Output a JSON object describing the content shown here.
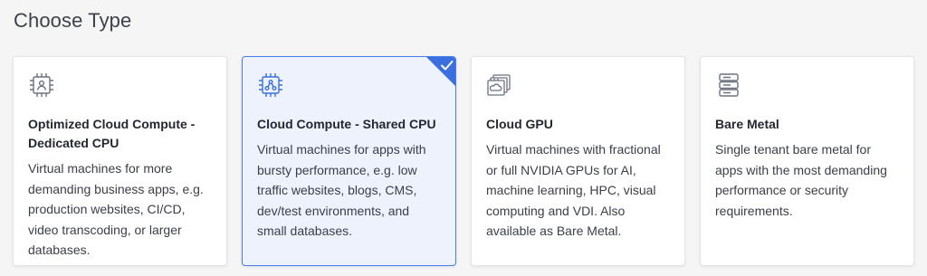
{
  "page": {
    "title": "Choose Type"
  },
  "cards": [
    {
      "title": "Optimized Cloud Compute - Dedicated CPU",
      "description": "Virtual machines for more demanding business apps, e.g. production websites, CI/CD, video transcoding, or larger databases.",
      "icon": "dedicated-cpu-icon",
      "selected": false
    },
    {
      "title": "Cloud Compute - Shared CPU",
      "description": "Virtual machines for apps with bursty performance, e.g. low traffic websites, blogs, CMS, dev/test environments, and small databases.",
      "icon": "shared-cpu-icon",
      "selected": true
    },
    {
      "title": "Cloud GPU",
      "description": "Virtual machines with fractional or full NVIDIA GPUs for AI, machine learning, HPC, visual computing and VDI. Also available as Bare Metal.",
      "icon": "gpu-icon",
      "selected": false
    },
    {
      "title": "Bare Metal",
      "description": "Single tenant bare metal for apps with the most demanding performance or security requirements.",
      "icon": "server-rack-icon",
      "selected": false
    }
  ],
  "colors": {
    "accent": "#3b6fe0",
    "selected_background": "#edf2fd",
    "icon_gray": "#6b7280"
  }
}
